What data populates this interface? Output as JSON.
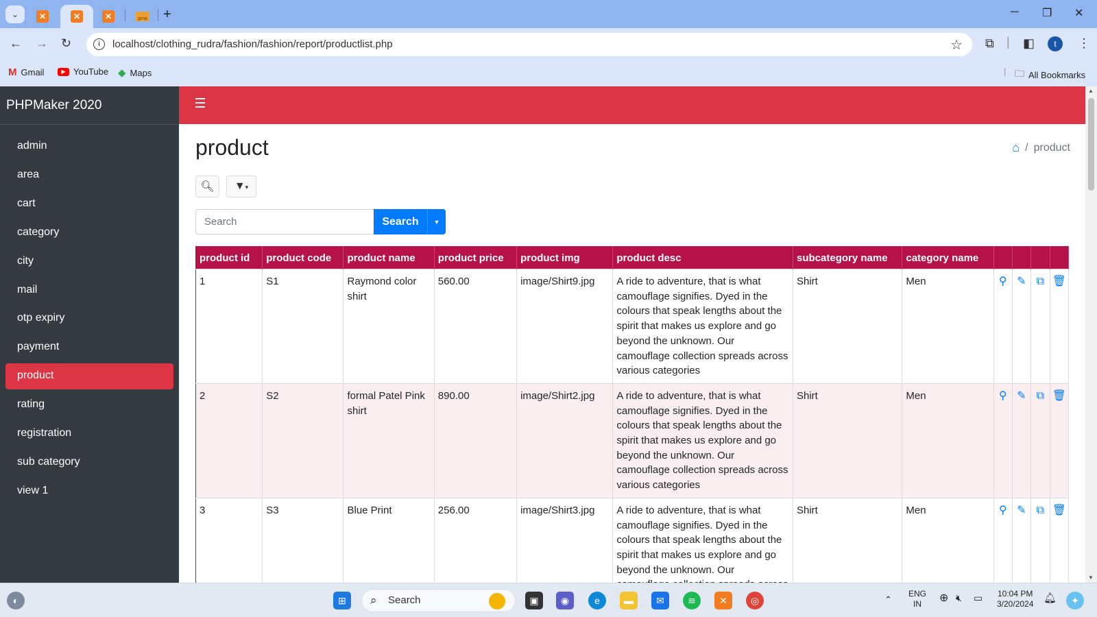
{
  "browser": {
    "url": "localhost/clothing_rudra/fashion/fashion/report/productlist.php",
    "bookmarks": [
      "Gmail",
      "YouTube",
      "Maps"
    ],
    "all_bookmarks": "All Bookmarks",
    "profile_initial": "t"
  },
  "app": {
    "brand": "PHPMaker 2020",
    "nav_items": [
      "admin",
      "area",
      "cart",
      "category",
      "city",
      "mail",
      "otp expiry",
      "payment",
      "product",
      "rating",
      "registration",
      "sub category",
      "view 1"
    ],
    "active_nav": "product"
  },
  "page": {
    "title": "product",
    "breadcrumb_current": "product",
    "search_placeholder": "Search",
    "search_button": "Search"
  },
  "table": {
    "columns": [
      "product id",
      "product code",
      "product name",
      "product price",
      "product img",
      "product desc",
      "subcategory name",
      "category name"
    ],
    "rows": [
      {
        "id": "1",
        "code": "S1",
        "name": "Raymond color shirt",
        "price": "560.00",
        "img": "image/Shirt9.jpg",
        "desc": "A ride to adventure, that is what camouflage signifies. Dyed in the colours that speak lengths about the spirit that makes us explore and go beyond the unknown. Our camouflage collection spreads across various categories",
        "subcategory": "Shirt",
        "category": "Men"
      },
      {
        "id": "2",
        "code": "S2",
        "name": "formal Patel Pink shirt",
        "price": "890.00",
        "img": "image/Shirt2.jpg",
        "desc": "A ride to adventure, that is what camouflage signifies. Dyed in the colours that speak lengths about the spirit that makes us explore and go beyond the unknown. Our camouflage collection spreads across various categories",
        "subcategory": "Shirt",
        "category": "Men"
      },
      {
        "id": "3",
        "code": "S3",
        "name": "Blue Print",
        "price": "256.00",
        "img": "image/Shirt3.jpg",
        "desc": "A ride to adventure, that is what camouflage signifies. Dyed in the colours that speak lengths about the spirit that makes us explore and go beyond the unknown. Our camouflage collection spreads across various categories",
        "subcategory": "Shirt",
        "category": "Men"
      }
    ]
  },
  "taskbar": {
    "search": "Search",
    "lang_line1": "ENG",
    "lang_line2": "IN",
    "time": "10:04 PM",
    "date": "3/20/2024"
  },
  "colors": {
    "accent": "#dc3545",
    "table_header": "#b5124a",
    "sidebar": "#343a40",
    "primary": "#007bff"
  }
}
